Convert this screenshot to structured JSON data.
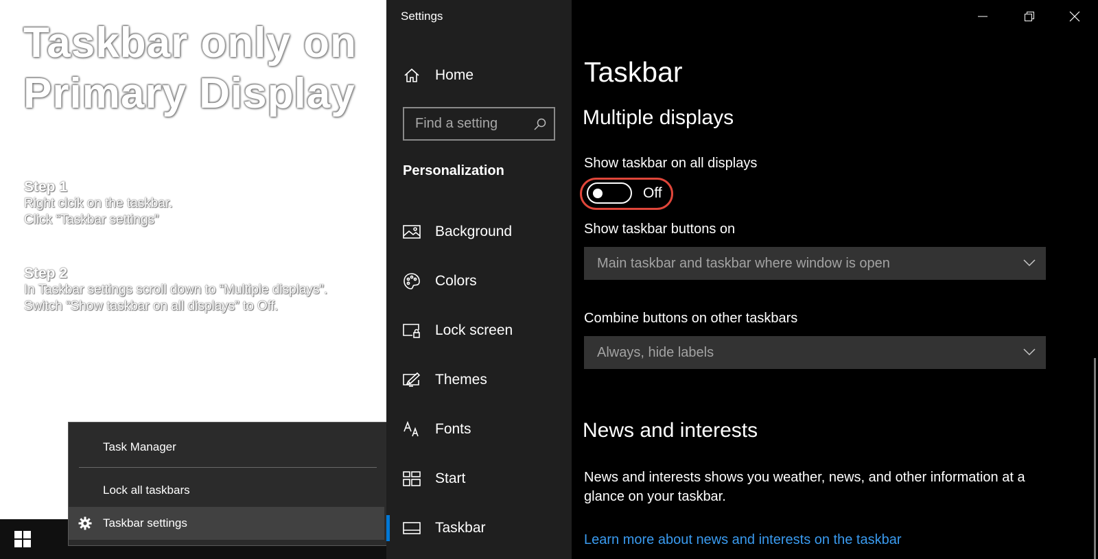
{
  "tutorial": {
    "title": "Taskbar only on Primary Display",
    "step1_heading": "Step 1",
    "step1_line1": "Right clcik on the taskbar.",
    "step1_line2": "Click “Taskbar settings”",
    "step2_heading": "Step 2",
    "step2_line1": "In Taskbar settings scroll down to “Multiple displays”.",
    "step2_line2": "Switch “Show taskbar on all displays” to  Off."
  },
  "context_menu": {
    "items": [
      {
        "label": "Task Manager"
      },
      {
        "label": "Lock all taskbars"
      },
      {
        "label": "Taskbar settings",
        "icon": "gear-icon",
        "highlighted": true
      }
    ]
  },
  "settings": {
    "app_title": "Settings",
    "nav": {
      "home": "Home",
      "search_placeholder": "Find a setting",
      "section": "Personalization",
      "items": [
        {
          "label": "Background",
          "icon": "picture-icon"
        },
        {
          "label": "Colors",
          "icon": "palette-icon"
        },
        {
          "label": "Lock screen",
          "icon": "lock-screen-icon"
        },
        {
          "label": "Themes",
          "icon": "themes-icon"
        },
        {
          "label": "Fonts",
          "icon": "fonts-icon"
        },
        {
          "label": "Start",
          "icon": "start-icon"
        },
        {
          "label": "Taskbar",
          "icon": "taskbar-icon",
          "selected": true
        }
      ]
    },
    "content": {
      "page_title": "Taskbar",
      "multiple_displays": {
        "header": "Multiple displays",
        "show_all_label": "Show taskbar on all displays",
        "toggle_state": "Off",
        "buttons_on_label": "Show taskbar buttons on",
        "buttons_on_value": "Main taskbar and taskbar where window is open",
        "combine_label": "Combine buttons on other taskbars",
        "combine_value": "Always, hide labels"
      },
      "news": {
        "header": "News and interests",
        "description": "News and interests shows you weather, news, and other information at a glance on your taskbar.",
        "link": "Learn more about news and interests on the taskbar"
      }
    }
  },
  "colors": {
    "accent": "#0078d7",
    "highlight_ring": "#e0463a",
    "link": "#3a9bf0"
  }
}
